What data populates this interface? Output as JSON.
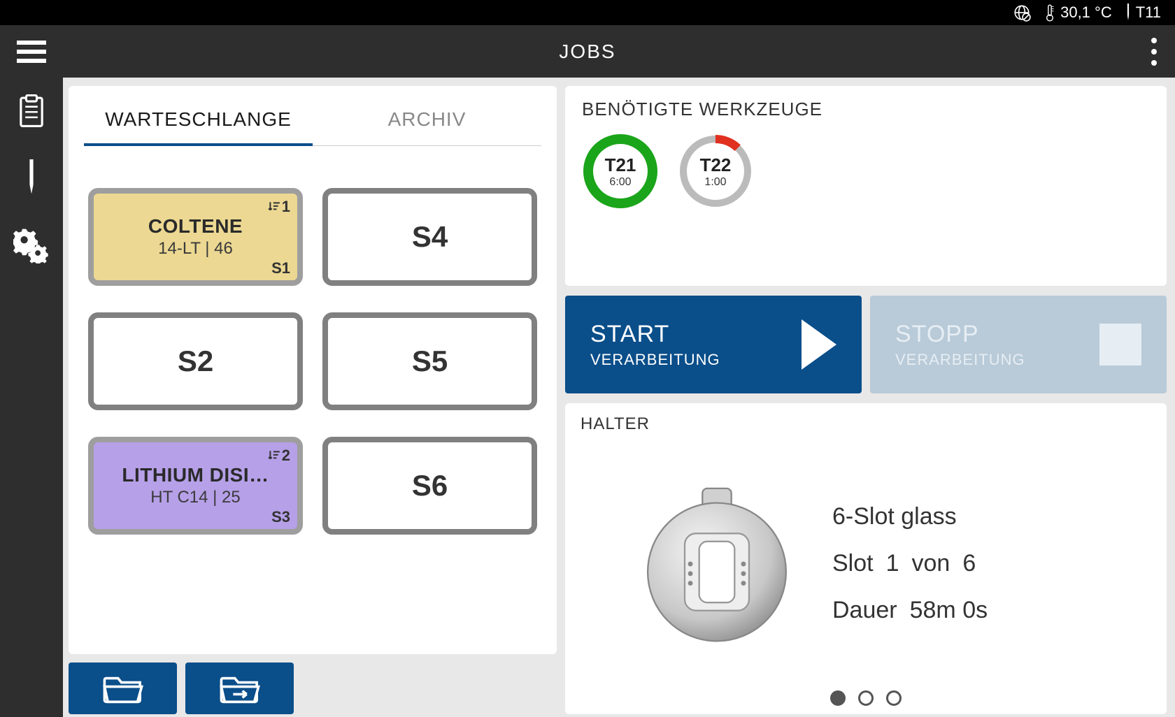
{
  "status_bar": {
    "temperature": "30,1 °C",
    "tool_current": "T11"
  },
  "header": {
    "title": "JOBS"
  },
  "tabs": {
    "queue": "WARTESCHLANGE",
    "archive": "ARCHIV"
  },
  "slots": {
    "s1": {
      "id": "S1",
      "title": "COLTENE",
      "subtitle": "14-LT | 46",
      "queue_pos": "1"
    },
    "s2": {
      "id": "S2",
      "label": "S2"
    },
    "s3": {
      "id": "S3",
      "title": "LITHIUM DISI…",
      "subtitle": "HT C14 | 25",
      "queue_pos": "2"
    },
    "s4": {
      "id": "S4",
      "label": "S4"
    },
    "s5": {
      "id": "S5",
      "label": "S5"
    },
    "s6": {
      "id": "S6",
      "label": "S6"
    }
  },
  "tools_panel": {
    "title": "BENÖTIGTE WERKZEUGE",
    "t1": {
      "name": "T21",
      "time": "6:00",
      "percent": 100,
      "color": "#1aa51a"
    },
    "t2": {
      "name": "T22",
      "time": "1:00",
      "percent": 12,
      "color": "#e03020"
    }
  },
  "controls": {
    "start_line1": "START",
    "start_line2": "VERARBEITUNG",
    "stop_line1": "STOPP",
    "stop_line2": "VERARBEITUNG"
  },
  "holder": {
    "title": "HALTER",
    "name": "6-Slot glass",
    "slot_label": "Slot",
    "slot_num": "1",
    "slot_of": "von",
    "slot_total": "6",
    "duration_label": "Dauer",
    "duration_value": "58m 0s"
  }
}
